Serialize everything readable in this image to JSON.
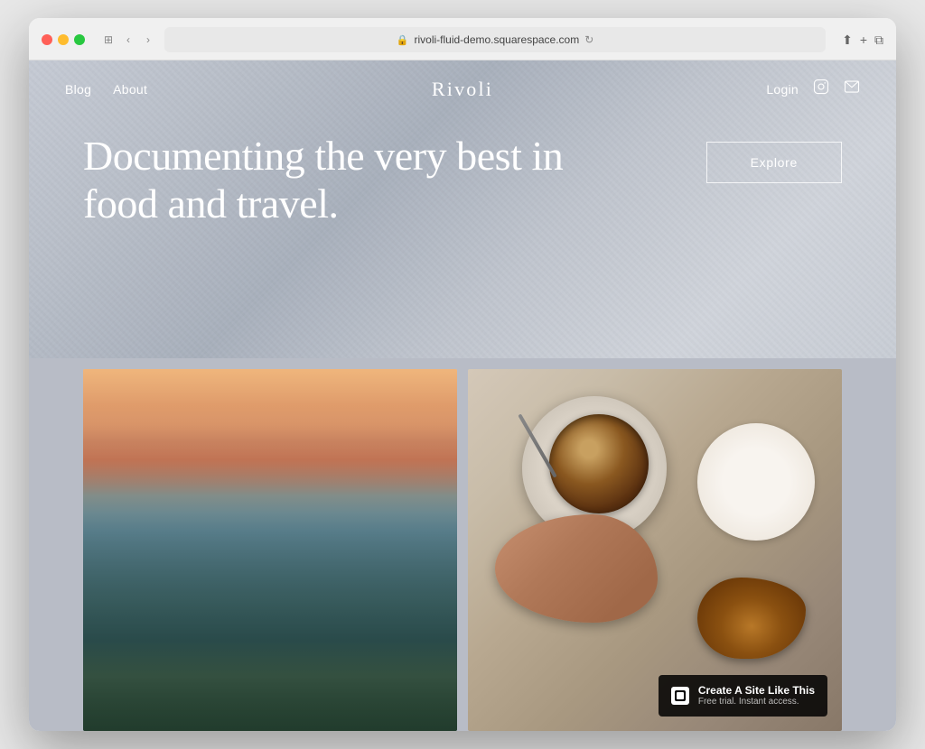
{
  "browser": {
    "url": "rivoli-fluid-demo.squarespace.com",
    "refresh_label": "↻"
  },
  "nav": {
    "blog_label": "Blog",
    "about_label": "About",
    "site_title": "Rivoli",
    "login_label": "Login"
  },
  "hero": {
    "headline": "Documenting the very best in food and travel.",
    "explore_btn": "Explore"
  },
  "images": {
    "coastal_alt": "Coastal landscape at sunset",
    "coffee_alt": "Coffee and croissant overhead view"
  },
  "badge": {
    "title": "Create A Site Like This",
    "subtitle": "Free trial. Instant access."
  }
}
